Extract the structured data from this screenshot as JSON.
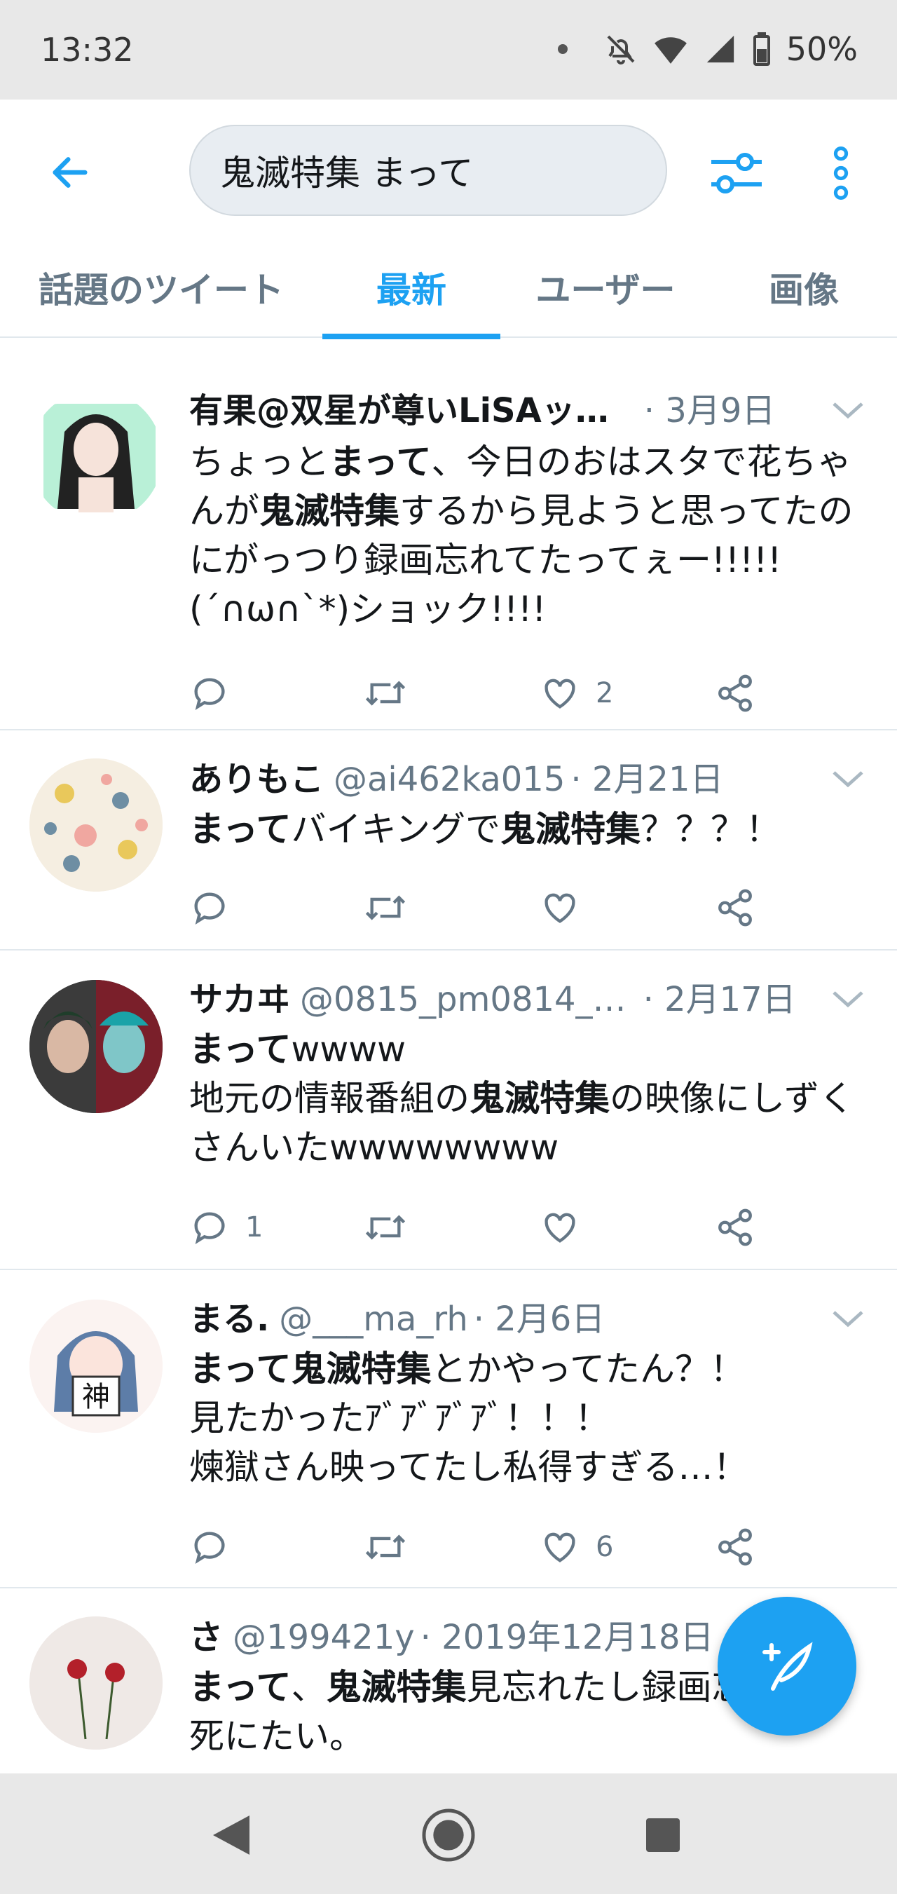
{
  "status_bar": {
    "time": "13:32",
    "battery": "50%"
  },
  "header": {
    "search_query": "鬼滅特集 まって",
    "tabs": [
      {
        "label": "話題のツイート",
        "active": false
      },
      {
        "label": "最新",
        "active": true
      },
      {
        "label": "ユーザー",
        "active": false
      },
      {
        "label": "画像",
        "active": false
      }
    ]
  },
  "tweets": [
    {
      "name": "有果@双星が尊いLiSAッ…",
      "handle": "",
      "date": "· 3月9日",
      "text_parts": [
        "ちょっと",
        "まって",
        "、今日のおはスタで花ちゃんが",
        "鬼滅特集",
        "するから見ようと思ってたのにがっつり録画忘れてたってぇー!!!!!(´∩ω∩`*)ショック!!!!"
      ],
      "replies": "",
      "likes": "2"
    },
    {
      "name": "ありもこ",
      "handle": "@ai462ka015",
      "date": "· 2月21日",
      "text_parts": [
        "まって",
        "バイキングで",
        "鬼滅特集",
        "？？？！"
      ],
      "replies": "",
      "likes": ""
    },
    {
      "name": "サカヰ",
      "handle": "@0815_pm0814_…",
      "date": "· 2月17日",
      "text_parts": [
        "まって",
        "wwww",
        "地元の情報番組の",
        "鬼滅特集",
        "の映像にしずくさんいたwwwwwwww"
      ],
      "replies": "1",
      "likes": ""
    },
    {
      "name": "まる.",
      "handle": "@___ma_rh",
      "date": "· 2月6日",
      "text_parts": [
        "まって鬼滅特集",
        "とかやってたん？！",
        "見たかったｱﾞｱﾞｱﾞｱﾞ！！！",
        "煉獄さん映ってたし私得すぎる…！"
      ],
      "replies": "",
      "likes": "6"
    },
    {
      "name": "さ",
      "handle": "@199421y",
      "date": "· 2019年12月18日",
      "text_parts": [
        "まって",
        "、",
        "鬼滅特集",
        "見忘れたし録画忘れた。死にたい。"
      ],
      "replies": "",
      "likes": ""
    }
  ],
  "icons": {
    "back": "arrow-left-icon",
    "filter": "sliders-icon",
    "more": "more-vertical-icon",
    "reply": "reply-icon",
    "retweet": "retweet-icon",
    "like": "heart-icon",
    "share": "share-icon",
    "compose": "compose-icon"
  },
  "colors": {
    "accent": "#1da1f2",
    "muted": "#657786",
    "text": "#14171a"
  }
}
